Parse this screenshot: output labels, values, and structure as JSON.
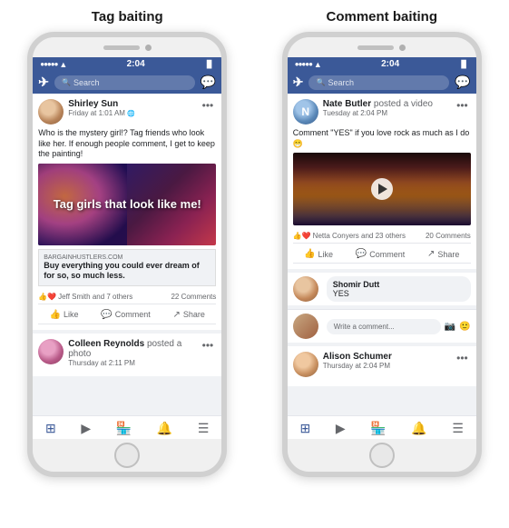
{
  "page": {
    "title1": "Tag baiting",
    "title2": "Comment baiting"
  },
  "phone1": {
    "statusBar": {
      "signal": "●●●●●",
      "wifi": "WiFi",
      "time": "2:04",
      "battery": "🔋"
    },
    "nav": {
      "searchPlaceholder": "Search"
    },
    "post1": {
      "author": "Shirley Sun",
      "date": "Friday at 1:01 AM",
      "text": "Who is the mystery girl!? Tag friends who look like her. If enough people comment, I get to keep the painting!",
      "imageText": "Tag girls\nthat look\nlike me!",
      "linkDomain": "BARGAINHUSTLERS.COM",
      "linkTitle": "Buy everything you could ever dream of for so, so much less.",
      "reactors": "Jeff Smith and 7 others",
      "commentCount": "22 Comments",
      "likeLabel": "Like",
      "commentLabel": "Comment",
      "shareLabel": "Share"
    },
    "post2": {
      "author": "Colleen Reynolds",
      "date": "Thursday at 2:11 PM",
      "action": "posted a photo"
    }
  },
  "phone2": {
    "statusBar": {
      "signal": "●●●●●",
      "wifi": "WiFi",
      "time": "2:04",
      "battery": "🔋"
    },
    "nav": {
      "searchPlaceholder": "Search"
    },
    "post1": {
      "author": "Nate Butler",
      "action": "posted a video",
      "date": "Tuesday at 2:04 PM",
      "text": "Comment \"YES\" if you love rock as much as I do 😁",
      "reactors": "Netta Conyers and 23 others",
      "commentCount": "20 Comments",
      "likeLabel": "Like",
      "commentLabel": "Comment",
      "shareLabel": "Share"
    },
    "comment1": {
      "author": "Shomir Dutt",
      "text": "YES"
    },
    "commentInput": {
      "placeholder": "Write a comment..."
    },
    "post2": {
      "author": "Alison Schumer",
      "date": "Thursday at 2:04 PM"
    }
  }
}
